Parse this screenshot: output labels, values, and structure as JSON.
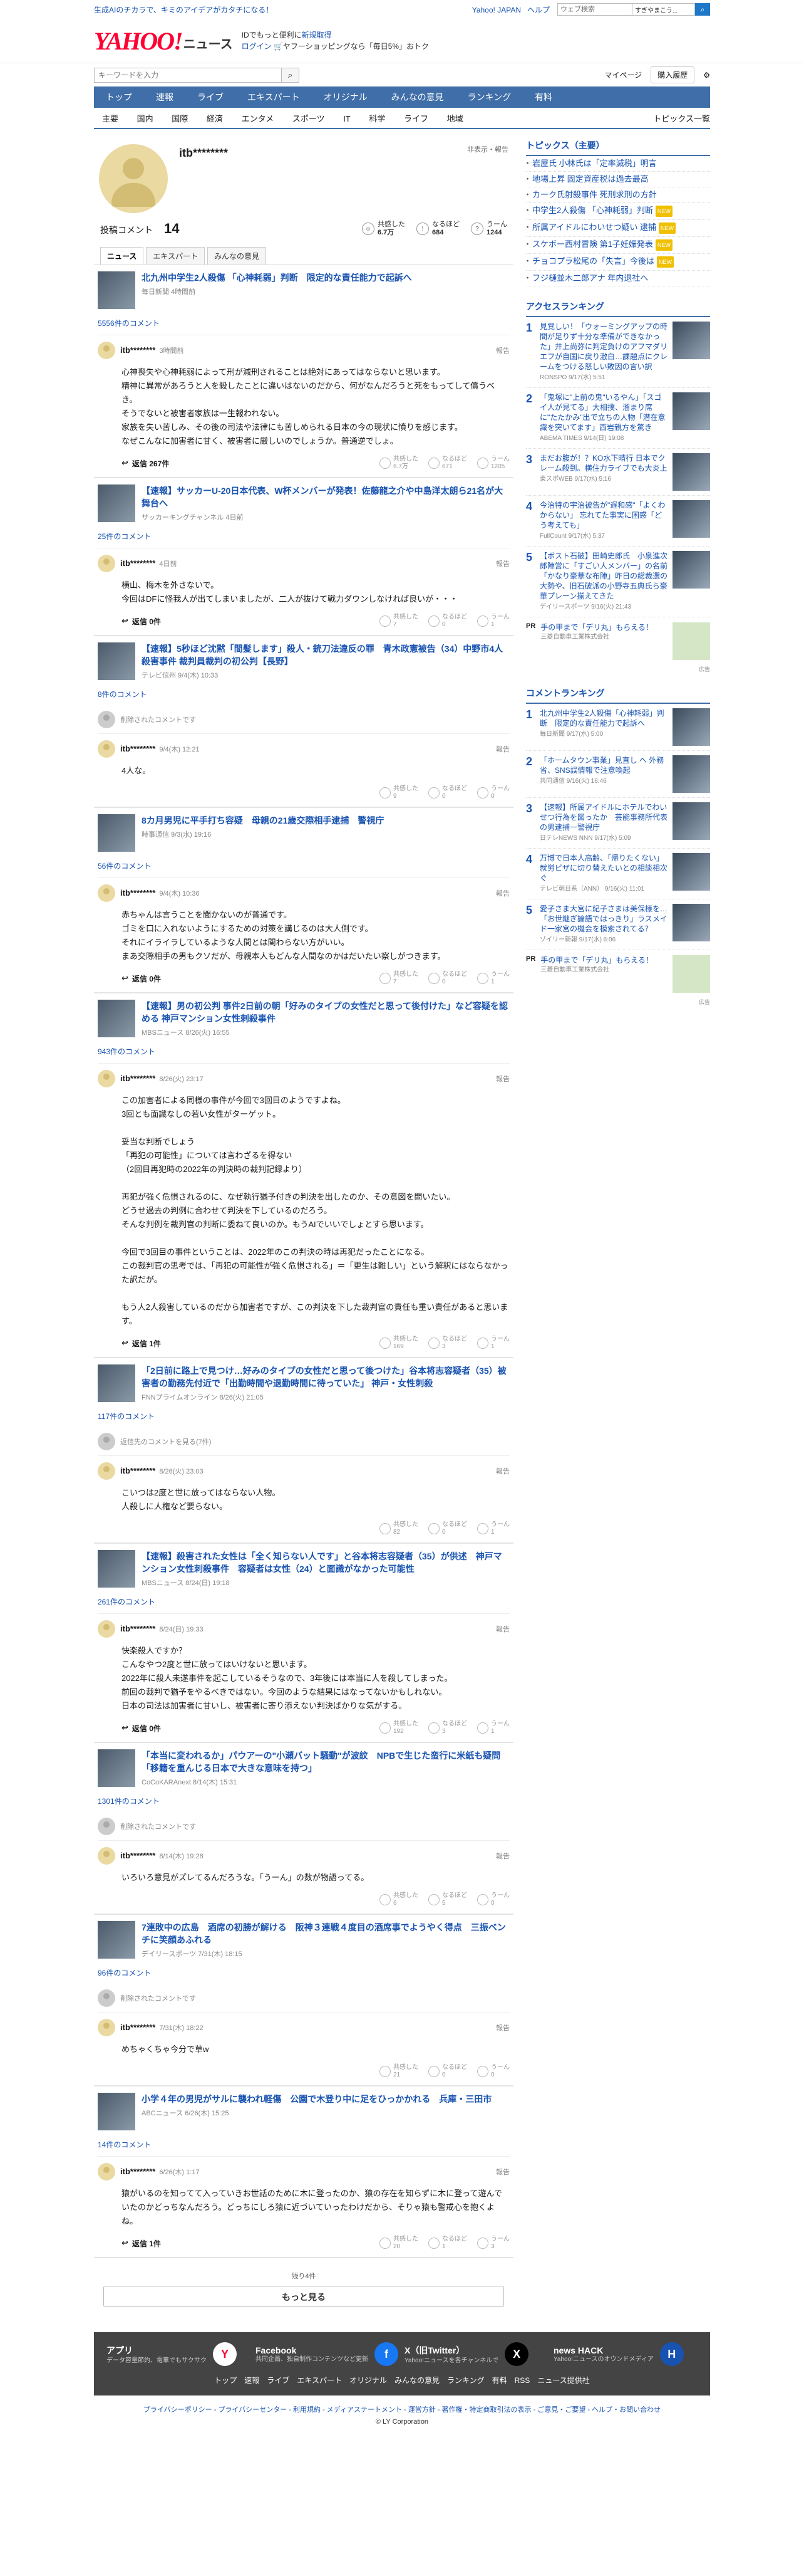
{
  "topbar": {
    "promo": "生成AIのチカラで、キミのアイデアがカタチになる！",
    "links": [
      "Yahoo! JAPAN",
      "ヘルプ"
    ],
    "search_placeholder": "ウェブ検索",
    "search_scope": "すぎやまこう..."
  },
  "header": {
    "logo_main": "YAHOO!",
    "logo_sub": "JAPAN",
    "logo_news": "ニュース",
    "promo_line1": "IDでもっと便利に",
    "promo_link1": "新規取得",
    "promo_line2": "ログイン",
    "promo_line2b": "ヤフーショッピングなら「毎日5%」おトク"
  },
  "search": {
    "placeholder": "キーワードを入力",
    "mypage": "マイページ",
    "subscribe": "購入履歴"
  },
  "nav": {
    "main": [
      "トップ",
      "速報",
      "ライブ",
      "エキスパート",
      "オリジナル",
      "みんなの意見",
      "ランキング",
      "有料"
    ],
    "sub": [
      "主要",
      "国内",
      "国際",
      "経済",
      "エンタメ",
      "スポーツ",
      "IT",
      "科学",
      "ライフ",
      "地域"
    ],
    "topics_list": "トピックス一覧"
  },
  "profile": {
    "name": "itb********",
    "side_link": "非表示・報告",
    "comment_label": "投稿コメント",
    "comment_count": "14",
    "reactions": [
      {
        "label": "共感した",
        "value": "6.7万"
      },
      {
        "label": "なるほど",
        "value": "684"
      },
      {
        "label": "うーん",
        "value": "1244"
      }
    ],
    "tabs": [
      "ニュース",
      "エキスパート",
      "みんなの意見"
    ]
  },
  "feed": [
    {
      "title": "北九州中学生2人殺傷 「心神耗弱」判断　限定的な責任能力で起訴へ",
      "meta": "毎日新聞 4時間前",
      "count": "5556件のコメント",
      "comments": [
        {
          "user": "itb********",
          "date": "3時間前",
          "text": "心神喪失や心神耗弱によって刑が減刑されることは絶対にあってはならないと思います。\n精神に異常があろうと人を殺したことに違いはないのだから、何がなんだろうと死をもってして償うべき。\nそうでないと被害者家族は一生報われない。\n家族を失い苦しみ、その後の司法や法律にも苦しめられる日本の今の現状に憤りを感じます。\nなぜこんなに加害者に甘く、被害者に厳しいのでしょうか。普通逆でしょ。",
          "replies": "返信 267件",
          "r": [
            "6.7万",
            "671",
            "1205"
          ]
        }
      ]
    },
    {
      "title": "【速報】サッカーU-20日本代表、W杯メンバーが発表！佐藤龍之介や中島洋太朗ら21名が大舞台へ",
      "meta": "サッカーキングチャンネル 4日前",
      "count": "25件のコメント",
      "comments": [
        {
          "user": "itb********",
          "date": "4日前",
          "text": "横山、梅木を外さないで。\n今回はDFに怪我人が出てしまいましたが、二人が抜けて戦力ダウンしなければ良いが・・・",
          "replies": "返信 0件",
          "r": [
            "7",
            "0",
            "1"
          ]
        }
      ]
    },
    {
      "title": "【速報】5秒ほど沈黙「間髪します」殺人・銃刀法違反の罪　青木政憲被告（34）中野市4人殺害事件 裁判員裁判の初公判【長野】",
      "meta": "テレビ信州 9/4(木) 10:33",
      "count": "8件のコメント",
      "deleted": "削除されたコメントです",
      "comments": [
        {
          "user": "itb********",
          "date": "9/4(木) 12:21",
          "text": "4人な。",
          "replies": "",
          "r": [
            "9",
            "0",
            "0"
          ]
        }
      ]
    },
    {
      "title": "8カ月男児に平手打ち容疑　母親の21歳交際相手逮捕　警視庁",
      "meta": "時事通信 9/3(水) 19:16",
      "count": "56件のコメント",
      "comments": [
        {
          "user": "itb********",
          "date": "9/4(木) 10:36",
          "text": "赤ちゃんは言うことを聞かないのが普通です。\nゴミを口に入れないようにするための対策を講じるのは大人側です。\nそれにイライラしているような人間とは関わらない方がいい。\nまあ交際相手の男もクソだが、母親本人もどんな人間なのかはだいたい察しがつきます。",
          "replies": "返信 0件",
          "r": [
            "7",
            "0",
            "1"
          ]
        }
      ]
    },
    {
      "title": "【速報】男の初公判 事件2日前の朝「好みのタイプの女性だと思って後付けた」など容疑を認める 神戸マンション女性刺殺事件",
      "meta": "MBSニュース 8/26(火) 16:55",
      "count": "943件のコメント",
      "comments": [
        {
          "user": "itb********",
          "date": "8/26(火) 23:17",
          "text": "この加害者による同様の事件が今回で3回目のようですよね。\n3回とも面識なしの若い女性がターゲット。\n\n妥当な判断でしょう\n「再犯の可能性」については言わざるを得ない\n（2回目再犯時の2022年の判決時の裁判記録より）\n\n再犯が強く危惧されるのに、なぜ執行猶予付きの判決を出したのか、その意図を問いたい。\nどうせ過去の判例に合わせて判決を下しているのだろう。\nそんな判例を裁判官の判断に委ねて良いのか。もうAIでいいでしょとすら思います。\n\n今回で3回目の事件ということは、2022年のこの判決の時は再犯だったことになる。\nこの裁判官の思考では、「再犯の可能性が強く危惧される」＝「更生は難しい」という解釈にはならなかった訳だが。\n\nもう人2人殺害しているのだから加害者ですが、この判決を下した裁判官の責任も重い責任があると思います。",
          "replies": "返信 1件",
          "r": [
            "169",
            "3",
            "1"
          ]
        }
      ]
    },
    {
      "title": "「2日前に路上で見つけ…好みのタイプの女性だと思って後つけた」谷本将志容疑者（35）被害者の勤務先付近で「出勤時間や退勤時間に待っていた」 神戸・女性刺殺",
      "meta": "FNNプライムオンライン 8/26(火) 21:05",
      "count": "117件のコメント",
      "deleted": "返信先のコメントを見る(7件)",
      "comments": [
        {
          "user": "itb********",
          "date": "8/26(火) 23:03",
          "text": "こいつは2度と世に放ってはならない人物。\n人殺しに人権など要らない。",
          "replies": "",
          "r": [
            "82",
            "0",
            "1"
          ]
        }
      ]
    },
    {
      "title": "【速報】殺害された女性は「全く知らない人です」と谷本将志容疑者（35）が供述　神戸マンション女性刺殺事件　容疑者は女性（24）と面識がなかった可能性",
      "meta": "MBSニュース 8/24(日) 19:18",
      "count": "261件のコメント",
      "comments": [
        {
          "user": "itb********",
          "date": "8/24(日) 19:33",
          "text": "快楽殺人ですか？\nこんなやつ2度と世に放ってはいけないと思います。\n2022年に殺人未遂事件を起こしているそうなので、3年後には本当に人を殺してしまった。\n前回の裁判で猶予をやるべきではない。今回のような結果にはなってないかもしれない。\n日本の司法は加害者に甘いし、被害者に寄り添えない判決ばかりな気がする。",
          "replies": "返信 0件",
          "r": [
            "192",
            "3",
            "1"
          ]
        }
      ]
    },
    {
      "title": "「本当に変われるか」パウアーの\"小瀬バット騒動\"が波紋　NPBで生じた蛮行に米紙も疑問「移籍を重んじる日本で大きな意味を持つ」",
      "meta": "CoCoKARAnext 8/14(木) 15:31",
      "count": "1301件のコメント",
      "deleted": "削除されたコメントです",
      "comments": [
        {
          "user": "itb********",
          "date": "8/14(木) 19:28",
          "text": "いろいろ意見がズレてるんだろうな。「うーん」の数が物語ってる。",
          "replies": "",
          "r": [
            "6",
            "5",
            "0"
          ]
        }
      ]
    },
    {
      "title": "7連敗中の広島　酒席の初勝が解ける　阪神３連戦４度目の酒席事でようやく得点　三振ベンチに笑顔あふれる",
      "meta": "デイリースポーツ 7/31(木) 18:15",
      "count": "96件のコメント",
      "deleted": "削除されたコメントです",
      "comments": [
        {
          "user": "itb********",
          "date": "7/31(木) 18:22",
          "text": "めちゃくちゃ今分で草w",
          "replies": "",
          "r": [
            "21",
            "0",
            "0"
          ]
        }
      ]
    },
    {
      "title": "小学４年の男児がサルに襲われ軽傷　公園で木登り中に足をひっかかれる　兵庫・三田市",
      "meta": "ABCニュース 6/26(木) 15:25",
      "count": "14件のコメント",
      "comments": [
        {
          "user": "itb********",
          "date": "6/26(木) 1:17",
          "text": "猿がいるのを知ってて入っていきお世話のために木に登ったのか、猿の存在を知らずに木に登って遊んでいたのかどっちなんだろう。どっちにしろ猿に近づいていったわけだから、そりゃ猿も警戒心を抱くよね。",
          "replies": "返信 1件",
          "r": [
            "20",
            "1",
            "3"
          ]
        }
      ]
    }
  ],
  "more": {
    "remaining": "残り4件",
    "button": "もっと見る"
  },
  "side": {
    "topics_title": "トピックス（主要）",
    "topics": [
      {
        "t": "岩屋氏 小林氏は「定率減税」明言",
        "b": ""
      },
      {
        "t": "地場上昇 固定資産税は過去最高",
        "b": ""
      },
      {
        "t": "カーク氏射殺事件 死刑求刑の方針",
        "b": ""
      },
      {
        "t": "中学生2人殺傷 「心神耗弱」判断",
        "b": "NEW"
      },
      {
        "t": "所属アイドルにわいせつ疑い 逮捕",
        "b": "NEW"
      },
      {
        "t": "スケボー西村冒険 第1子妊娠発表",
        "b": "NEW"
      },
      {
        "t": "チョコプラ松尾の「失言」今後は",
        "b": "NEW"
      },
      {
        "t": "フジ樋並木二郎アナ 年内退社へ",
        "b": ""
      }
    ],
    "access_title": "アクセスランキング",
    "access": [
      {
        "t": "見覚しい！「ウォーミングアップの時間が足りず十分な準備ができなかった」井上尚弥に判定負けのアフマダリエフが自国に戻り激白…課題点にクレームをつける怒しい敗因の言い訳",
        "m": "RONSPO 9/17(水) 5:51"
      },
      {
        "t": "「鬼塚に\"上前の鬼\"いるやん」「スゴイ人が見てる」大相撲、溜まり席に\"たたかみ\"出で立ちの人物「潜在意識を突いてます」西岩親方を驚き",
        "m": "ABEMA TIMES 9/14(日) 19:08"
      },
      {
        "t": "まだお腹が！？KO水下晴行 日本でクレーム殺到。横住力ライブでも大炎上",
        "m": "東スポWEB 9/17(水) 5:16"
      },
      {
        "t": "今治特の宇治被告が\"遅和感\"「よくわからない」 忘れてた事実に困惑「どう考えても」",
        "m": "FullCount 9/17(水) 5:37"
      },
      {
        "t": "【ボスト石破】田崎史郎氏　小泉進次郎陣営に「すごい人メンバー」の名前「かなり豪華な布陣」昨日の総裁選の大勢や、旧石破派の小野寺五典氏ら豪華プレーン揃えてきた",
        "m": "デイリースポーツ 9/16(火) 21:43"
      }
    ],
    "pr1": {
      "label": "PR",
      "t": "手の甲まで「デリ丸」もらえる！",
      "m": "三菱自動車工業株式会社"
    },
    "comment_title": "コメントランキング",
    "comment_rank": [
      {
        "t": "北九州中学生2人殺傷「心神耗弱」判断　限定的な責任能力で起訴へ",
        "m": "毎日新聞 9/17(水) 5:00"
      },
      {
        "t": "「ホームタウン事業」見直し へ 外務省、SNS誤情報で注意喚起",
        "m": "共同通信 9/16(火) 16:46"
      },
      {
        "t": "【速報】所属アイドルにホテルでわいせつ行為を図ったか　芸能事務所代表の男逮捕ー警視庁",
        "m": "日テレNEWS NNN 9/17(水) 5:09"
      },
      {
        "t": "万博で日本人高齢、「帰りたくない」就労ビザに切り替えたいとの相談相次ぐ",
        "m": "テレビ朝日系（ANN） 9/16(火) 11:01"
      },
      {
        "t": "愛子さま大宮に紀子さまは美保様を…「お世継ぎ論語ではっきり」ラスメイド一家宮の機会を模索されてる？",
        "m": "ゾイリー新報 9/17(水) 6:06"
      }
    ],
    "pr2": {
      "label": "PR",
      "t": "手の甲まで「デリ丸」もらえる！",
      "m": "三菱自動車工業株式会社"
    },
    "ad_label": "広告"
  },
  "footer": {
    "items": [
      {
        "t": "アプリ",
        "s": "データ容量節約、電車でもサクサク",
        "i": "Y"
      },
      {
        "t": "Facebook",
        "s": "共同企画、独自制作コンテンツなど更新",
        "i": "f"
      },
      {
        "t": "X（旧Twitter）",
        "s": "Yahoo!ニュースを各チャンネルで",
        "i": "X"
      },
      {
        "t": "news HACK",
        "s": "Yahoo!ニュースのオウンドメディア",
        "i": "H"
      }
    ],
    "links": [
      "トップ",
      "速報",
      "ライブ",
      "エキスパート",
      "オリジナル",
      "みんなの意見",
      "ランキング",
      "有料",
      "RSS",
      "ニュース提供社"
    ],
    "legal": "プライバシーポリシー - プライバシーセンター - 利用規約 - メディアステートメント - 運営方針 - 著作権・特定商取引法の表示 - ご意見・ご要望 - ヘルプ・お問い合わせ",
    "copy": "© LY Corporation"
  }
}
